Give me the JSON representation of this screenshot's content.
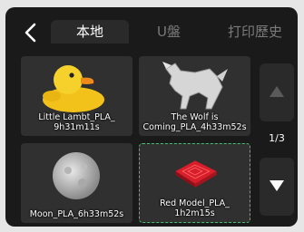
{
  "header": {
    "tabs": [
      {
        "label": "本地",
        "active": true
      },
      {
        "label": "U盤",
        "active": false
      },
      {
        "label": "打印歷史",
        "active": false
      }
    ]
  },
  "files": [
    {
      "name": "Little Lambt_PLA_\n9h31m11s",
      "thumb": "duck-model"
    },
    {
      "name": "The Wolf is\nComing_PLA_4h33m52s",
      "thumb": "wolf-model"
    },
    {
      "name": "Moon_PLA_6h33m52s",
      "thumb": "moon-model"
    },
    {
      "name": "Red Model_PLA_\n1h2m15s",
      "thumb": "red-tile-model",
      "selected": true
    }
  ],
  "pager": {
    "page_text": "1/3",
    "up_icon": "triangle-up-icon",
    "down_icon": "triangle-down-icon"
  },
  "colors": {
    "accent_selected": "#3fbf6f",
    "screen_bg": "#1a1a1a",
    "card_bg": "#303030"
  }
}
